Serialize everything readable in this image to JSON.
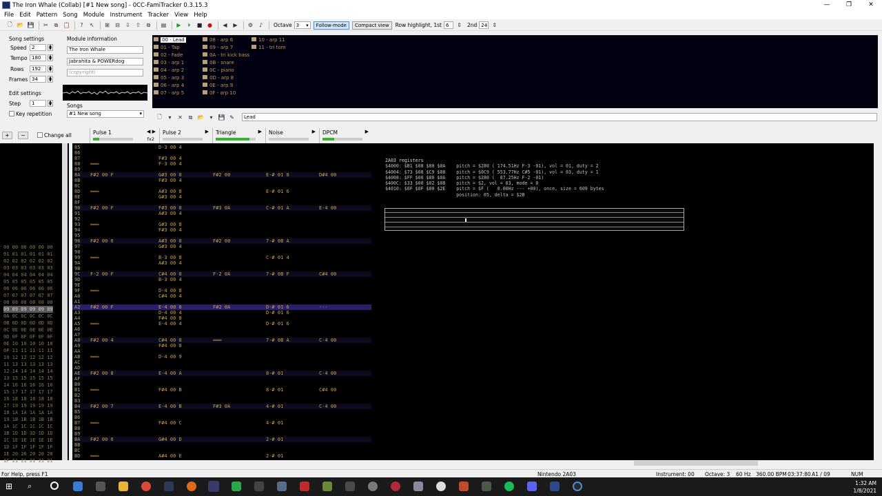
{
  "window": {
    "title": "The Iron Whale (Collab) [#1 New song] - 0CC-FamiTracker 0.3.15.3",
    "controls": [
      "—",
      "❐",
      "✕"
    ]
  },
  "menu": [
    "File",
    "Edit",
    "Pattern",
    "Song",
    "Module",
    "Instrument",
    "Tracker",
    "View",
    "Help"
  ],
  "toolbar": {
    "octave_label": "Octave",
    "octave_value": "3",
    "follow_mode": "Follow-mode",
    "compact_view": "Compact view",
    "row_highlight_label": "Row highlight, 1st",
    "row_highlight_1st": "6",
    "second_label": "2nd",
    "row_highlight_2nd": "24"
  },
  "song_settings": {
    "title": "Song settings",
    "speed_label": "Speed",
    "speed": "2",
    "tempo_label": "Tempo",
    "tempo": "180",
    "rows_label": "Rows",
    "rows": "192",
    "frames_label": "Frames",
    "frames": "34"
  },
  "edit_settings": {
    "title": "Edit settings",
    "step_label": "Step",
    "step": "1",
    "key_repetition": "Key repetition"
  },
  "module_info": {
    "title": "Module information",
    "name": "The Iron Whale",
    "artist": "Jabrahita & POWERdog",
    "copyright_placeholder": "(copyright)"
  },
  "songs": {
    "title": "Songs",
    "selected": "#1 New song"
  },
  "instruments": [
    {
      "label": "00 - Lead",
      "selected": true
    },
    {
      "label": "01 - Tap"
    },
    {
      "label": "02 - Fade"
    },
    {
      "label": "03 - arp 1"
    },
    {
      "label": "04 - arp 2"
    },
    {
      "label": "05 - arp 3"
    },
    {
      "label": "06 - arp 4"
    },
    {
      "label": "07 - arp 5"
    },
    {
      "label": "08 - arp 6"
    },
    {
      "label": "09 - arp 7"
    },
    {
      "label": "0A - tri kick bass"
    },
    {
      "label": "0B - snare"
    },
    {
      "label": "0C - piano"
    },
    {
      "label": "0D - arp 8"
    },
    {
      "label": "0E - arp 9"
    },
    {
      "label": "0F - arp 10"
    },
    {
      "label": "10 - arp 11"
    },
    {
      "label": "11 - tri tom"
    }
  ],
  "instrument_name": "Lead",
  "frames_panel": {
    "change_all": "Change all"
  },
  "channels": [
    {
      "name": "Pulse 1",
      "fx": "fx2",
      "level": 0.15
    },
    {
      "name": "Pulse 2",
      "level": 0
    },
    {
      "name": "Triangle",
      "level": 0.85
    },
    {
      "name": "Noise",
      "level": 0
    },
    {
      "name": "DPCM",
      "level": 0.3
    }
  ],
  "frame_list": [
    "00 00 00 00 00 00",
    "01 01 01 01 01 01",
    "02 02 02 02 02 02",
    "03 03 03 03 03 03",
    "04 04 04 04 04 04",
    "05 05 05 05 05 05",
    "06 06 06 06 06 06",
    "07 07 07 07 07 07",
    "08 08 08 08 08 08",
    "09 09 09 09 09 09",
    "0A 0C 0C 0C 0C 0C",
    "0B 0D 0D 0D 0D 0D",
    "0C 0E 0E 0E 0E 0E",
    "0D 0F 0F 0F 0F 0F",
    "0E 10 10 10 10 10",
    "0F 11 11 11 11 11",
    "10 12 12 12 12 12",
    "11 13 13 13 13 13",
    "12 14 14 14 14 14",
    "13 15 15 15 15 15",
    "14 16 16 16 16 16",
    "15 17 17 17 17 17",
    "16 18 18 18 18 18",
    "17 19 19 19 19 19",
    "18 1A 1A 1A 1A 1A",
    "19 1B 1B 1B 1B 1B",
    "1A 1C 1C 1C 1C 1C",
    "1B 1D 1D 1D 1D 1D",
    "1C 1E 1E 1E 1E 1E",
    "1D 1F 1F 1F 1F 1F",
    "1E 20 20 20 20 20",
    "1F 21 21 21 21 21"
  ],
  "selected_frame": 9,
  "pattern_rows": [
    {
      "n": "85",
      "c1": "",
      "c2": "D-3 00 4",
      "c3": "",
      "c4": "",
      "c5": ""
    },
    {
      "n": "86",
      "c1": "",
      "c2": "",
      "c3": "",
      "c4": "",
      "c5": ""
    },
    {
      "n": "87",
      "c1": "",
      "c2": "F#3 00 4",
      "c3": "",
      "c4": "",
      "c5": ""
    },
    {
      "n": "88",
      "c1": "═══",
      "c2": "F-3 00 4",
      "c3": "",
      "c4": "",
      "c5": ""
    },
    {
      "n": "89",
      "c1": "",
      "c2": "",
      "c3": "",
      "c4": "",
      "c5": ""
    },
    {
      "n": "8A",
      "c1": "F#2 00 F",
      "c2": "G#3 00 8",
      "c3": "F#2 00",
      "c4": "E-# 01 8",
      "c5": "D#4 00"
    },
    {
      "n": "8B",
      "c1": "",
      "c2": "F#3 00 4",
      "c3": "",
      "c4": "",
      "c5": ""
    },
    {
      "n": "8C",
      "c1": "",
      "c2": "",
      "c3": "",
      "c4": "",
      "c5": ""
    },
    {
      "n": "8D",
      "c1": "═══",
      "c2": "A#3 00 8",
      "c3": "",
      "c4": "E-# 01 6",
      "c5": ""
    },
    {
      "n": "8E",
      "c1": "",
      "c2": "G#3 00 4",
      "c3": "",
      "c4": "",
      "c5": ""
    },
    {
      "n": "8F",
      "c1": "",
      "c2": "",
      "c3": "",
      "c4": "",
      "c5": ""
    },
    {
      "n": "90",
      "c1": "F#2 00 F",
      "c2": "F#3 00 8",
      "c3": "F#3 0A",
      "c4": "C-# 01 A",
      "c5": "E-4 00"
    },
    {
      "n": "91",
      "c1": "",
      "c2": "A#3 00 4",
      "c3": "",
      "c4": "",
      "c5": ""
    },
    {
      "n": "92",
      "c1": "",
      "c2": "",
      "c3": "",
      "c4": "",
      "c5": ""
    },
    {
      "n": "93",
      "c1": "═══",
      "c2": "G#3 00 8",
      "c3": "",
      "c4": "",
      "c5": ""
    },
    {
      "n": "94",
      "c1": "",
      "c2": "F#3 00 4",
      "c3": "",
      "c4": "",
      "c5": ""
    },
    {
      "n": "95",
      "c1": "",
      "c2": "",
      "c3": "",
      "c4": "",
      "c5": ""
    },
    {
      "n": "96",
      "c1": "F#2 00 6",
      "c2": "A#3 00 8",
      "c3": "F#2 00",
      "c4": "7-# 0B A",
      "c5": ""
    },
    {
      "n": "97",
      "c1": "",
      "c2": "G#3 00 4",
      "c3": "",
      "c4": "",
      "c5": ""
    },
    {
      "n": "98",
      "c1": "",
      "c2": "",
      "c3": "",
      "c4": "",
      "c5": ""
    },
    {
      "n": "99",
      "c1": "═══",
      "c2": "B-3 00 8",
      "c3": "",
      "c4": "C-# 01 4",
      "c5": ""
    },
    {
      "n": "9A",
      "c1": "",
      "c2": "A#3 00 4",
      "c3": "",
      "c4": "",
      "c5": ""
    },
    {
      "n": "9B",
      "c1": "",
      "c2": "",
      "c3": "",
      "c4": "",
      "c5": ""
    },
    {
      "n": "9C",
      "c1": "F-2 00 F",
      "c2": "C#4 00 8",
      "c3": "F-2 0A",
      "c4": "7-# 0B F",
      "c5": "C#4 00"
    },
    {
      "n": "9D",
      "c1": "",
      "c2": "B-3 00 4",
      "c3": "",
      "c4": "",
      "c5": ""
    },
    {
      "n": "9E",
      "c1": "",
      "c2": "",
      "c3": "",
      "c4": "",
      "c5": ""
    },
    {
      "n": "9F",
      "c1": "═══",
      "c2": "D-4 00 8",
      "c3": "",
      "c4": "",
      "c5": ""
    },
    {
      "n": "A0",
      "c1": "",
      "c2": "C#4 00 4",
      "c3": "",
      "c4": "",
      "c5": ""
    },
    {
      "n": "A1",
      "c1": "",
      "c2": "",
      "c3": "",
      "c4": "",
      "c5": ""
    },
    {
      "n": "A2",
      "c1": "F#2 00 F",
      "c2": "E-4 00 8",
      "c3": "F#2 0A",
      "c4": "D-# 01 6",
      "c5": "---",
      "cursor": true
    },
    {
      "n": "A3",
      "c1": "",
      "c2": "D-4 00 4",
      "c3": "",
      "c4": "D-# 01 6",
      "c5": ""
    },
    {
      "n": "A4",
      "c1": "",
      "c2": "F#4 00 8",
      "c3": "",
      "c4": "",
      "c5": ""
    },
    {
      "n": "A5",
      "c1": "═══",
      "c2": "E-4 00 4",
      "c3": "",
      "c4": "D-# 01 6",
      "c5": ""
    },
    {
      "n": "A6",
      "c1": "",
      "c2": "",
      "c3": "",
      "c4": "",
      "c5": ""
    },
    {
      "n": "A7",
      "c1": "",
      "c2": "",
      "c3": "",
      "c4": "",
      "c5": ""
    },
    {
      "n": "A8",
      "c1": "F#2 00 4",
      "c2": "C#4 00 8",
      "c3": "═══",
      "c4": "7-# 0B A",
      "c5": "C-4 00"
    },
    {
      "n": "A9",
      "c1": "",
      "c2": "F#4 00 8",
      "c3": "",
      "c4": "",
      "c5": ""
    },
    {
      "n": "AA",
      "c1": "",
      "c2": "",
      "c3": "",
      "c4": "",
      "c5": ""
    },
    {
      "n": "AB",
      "c1": "═══",
      "c2": "D-4 00 9",
      "c3": "",
      "c4": "",
      "c5": ""
    },
    {
      "n": "AC",
      "c1": "",
      "c2": "",
      "c3": "",
      "c4": "",
      "c5": ""
    },
    {
      "n": "AD",
      "c1": "",
      "c2": "",
      "c3": "",
      "c4": "",
      "c5": ""
    },
    {
      "n": "AE",
      "c1": "F#2 00 8",
      "c2": "E-4 00 A",
      "c3": "",
      "c4": "8-# 01",
      "c5": "C-4 00"
    },
    {
      "n": "AF",
      "c1": "",
      "c2": "",
      "c3": "",
      "c4": "",
      "c5": ""
    },
    {
      "n": "B0",
      "c1": "",
      "c2": "",
      "c3": "",
      "c4": "",
      "c5": ""
    },
    {
      "n": "B1",
      "c1": "═══",
      "c2": "F#4 00 B",
      "c3": "",
      "c4": "8-# 01",
      "c5": "C#4 00"
    },
    {
      "n": "B2",
      "c1": "",
      "c2": "",
      "c3": "",
      "c4": "",
      "c5": ""
    },
    {
      "n": "B3",
      "c1": "",
      "c2": "",
      "c3": "",
      "c4": "",
      "c5": ""
    },
    {
      "n": "B4",
      "c1": "F#2 00 7",
      "c2": "E-4 00 B",
      "c3": "F#3 0A",
      "c4": "4-# 01",
      "c5": "C-4 00"
    },
    {
      "n": "B5",
      "c1": "",
      "c2": "",
      "c3": "",
      "c4": "",
      "c5": ""
    },
    {
      "n": "B6",
      "c1": "",
      "c2": "",
      "c3": "",
      "c4": "",
      "c5": ""
    },
    {
      "n": "B7",
      "c1": "═══",
      "c2": "F#4 00 C",
      "c3": "",
      "c4": "4-# 01",
      "c5": ""
    },
    {
      "n": "B8",
      "c1": "",
      "c2": "",
      "c3": "",
      "c4": "",
      "c5": ""
    },
    {
      "n": "B9",
      "c1": "",
      "c2": "",
      "c3": "",
      "c4": "",
      "c5": ""
    },
    {
      "n": "BA",
      "c1": "F#2 00 6",
      "c2": "G#4 00 D",
      "c3": "",
      "c4": "2-# 01",
      "c5": ""
    },
    {
      "n": "BB",
      "c1": "",
      "c2": "",
      "c3": "",
      "c4": "",
      "c5": ""
    },
    {
      "n": "BC",
      "c1": "",
      "c2": "",
      "c3": "",
      "c4": "",
      "c5": ""
    },
    {
      "n": "BD",
      "c1": "═══",
      "c2": "A#4 00 E",
      "c3": "",
      "c4": "2-# 01",
      "c5": ""
    }
  ],
  "registers": {
    "title": "2A03 registers",
    "lines": [
      "$4000: $B1 $08 $80 $0A    pitch = $280 ( 174.51Hz F-3 -01), vol = 01, duty = 2",
      "$4004: $73 $08 $C9 $08    pitch = $0C9 ( 553.77Hz C#5 -01), vol = 03, duty = 1",
      "$4008: $FF $00 $80 $0A    pitch = $280 (  87.25Hz F-2 -01)",
      "$400C: $33 $00 $02 $08    pitch = $2, vol = 03, mode = 0",
      "$4010: $0F $0F $00 $2E    pitch = $F (   0.00Hz --- +00), once, size = 609 bytes",
      "                          position: 05, delta = $2B"
    ]
  },
  "status": {
    "help": "For Help, press F1",
    "chip": "Nintendo 2A03",
    "instrument": "Instrument: 00",
    "octave": "Octave: 3",
    "rate": "60 Hz",
    "bpm": "360.00 BPM",
    "time": "03:37:80",
    "position": "A1 / 09",
    "num": "NUM"
  },
  "clock": {
    "time": "1:32 AM",
    "date": "1/8/2021"
  }
}
